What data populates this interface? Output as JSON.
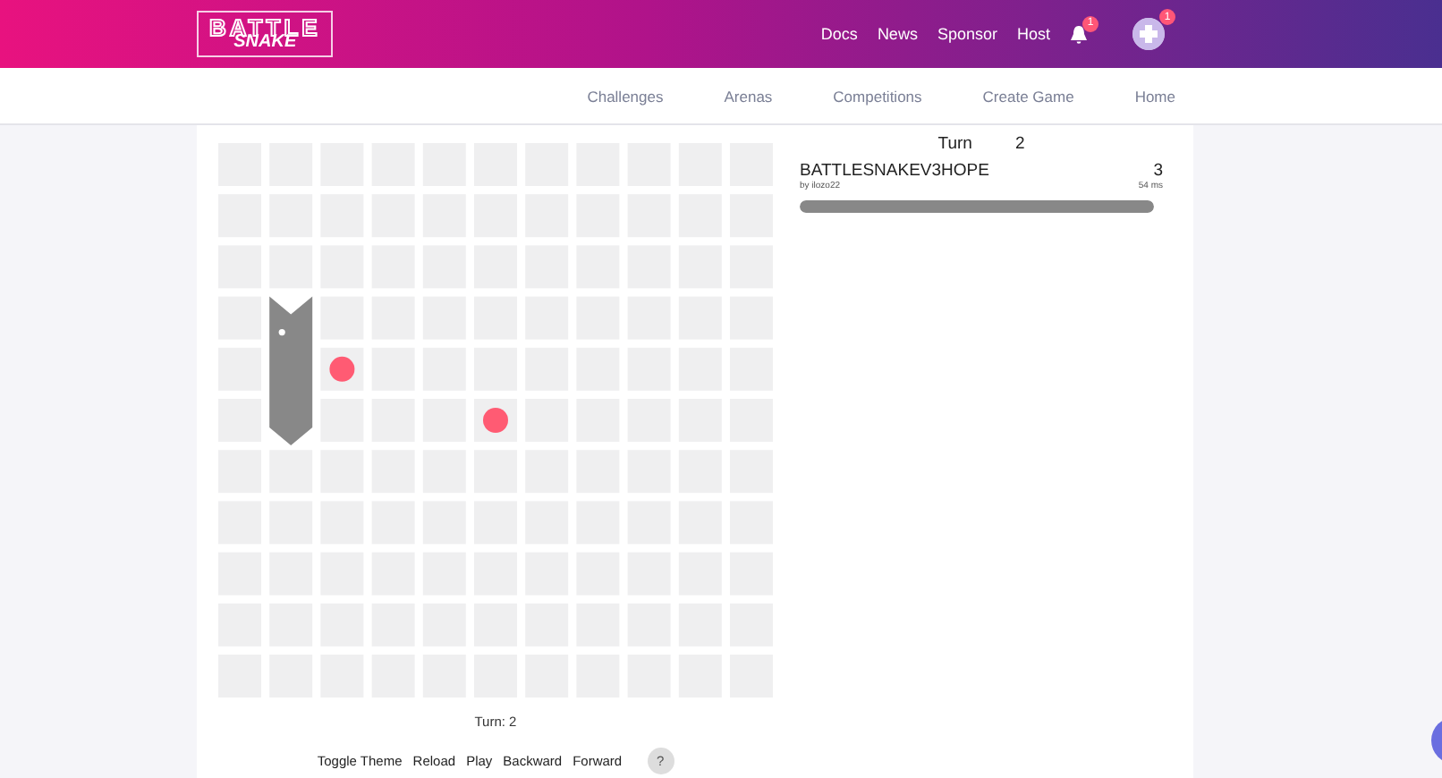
{
  "header": {
    "logo": [
      "BATTLE",
      "SNAKE"
    ],
    "links": [
      "Docs",
      "News",
      "Sponsor",
      "Host"
    ],
    "notification_badge": "1",
    "avatar_badge": "1"
  },
  "subnav": [
    "Challenges",
    "Arenas",
    "Competitions",
    "Create Game",
    "Home"
  ],
  "board": {
    "rows": [
      [
        {
          "kind": "empty"
        },
        {
          "kind": "empty"
        },
        {
          "kind": "empty"
        },
        {
          "kind": "empty"
        },
        {
          "kind": "empty"
        },
        {
          "kind": "empty"
        },
        {
          "kind": "empty"
        },
        {
          "kind": "empty"
        },
        {
          "kind": "empty"
        },
        {
          "kind": "empty"
        },
        {
          "kind": "empty"
        }
      ],
      [
        {
          "kind": "empty"
        },
        {
          "kind": "empty"
        },
        {
          "kind": "empty"
        },
        {
          "kind": "empty"
        },
        {
          "kind": "empty"
        },
        {
          "kind": "empty"
        },
        {
          "kind": "empty"
        },
        {
          "kind": "empty"
        },
        {
          "kind": "empty"
        },
        {
          "kind": "empty"
        },
        {
          "kind": "empty"
        }
      ],
      [
        {
          "kind": "empty"
        },
        {
          "kind": "empty"
        },
        {
          "kind": "empty"
        },
        {
          "kind": "empty"
        },
        {
          "kind": "empty"
        },
        {
          "kind": "empty"
        },
        {
          "kind": "empty"
        },
        {
          "kind": "empty"
        },
        {
          "kind": "empty"
        },
        {
          "kind": "empty"
        },
        {
          "kind": "empty"
        }
      ],
      [
        {
          "kind": "empty"
        },
        {
          "kind": "head"
        },
        {
          "kind": "empty"
        },
        {
          "kind": "empty"
        },
        {
          "kind": "empty"
        },
        {
          "kind": "empty"
        },
        {
          "kind": "empty"
        },
        {
          "kind": "empty"
        },
        {
          "kind": "empty"
        },
        {
          "kind": "empty"
        },
        {
          "kind": "empty"
        }
      ],
      [
        {
          "kind": "empty"
        },
        {
          "kind": "body"
        },
        {
          "kind": "food"
        },
        {
          "kind": "empty"
        },
        {
          "kind": "empty"
        },
        {
          "kind": "empty"
        },
        {
          "kind": "empty"
        },
        {
          "kind": "empty"
        },
        {
          "kind": "empty"
        },
        {
          "kind": "empty"
        },
        {
          "kind": "empty"
        }
      ],
      [
        {
          "kind": "empty"
        },
        {
          "kind": "tail"
        },
        {
          "kind": "empty"
        },
        {
          "kind": "empty"
        },
        {
          "kind": "empty"
        },
        {
          "kind": "food"
        },
        {
          "kind": "empty"
        },
        {
          "kind": "empty"
        },
        {
          "kind": "empty"
        },
        {
          "kind": "empty"
        },
        {
          "kind": "empty"
        }
      ],
      [
        {
          "kind": "empty"
        },
        {
          "kind": "empty"
        },
        {
          "kind": "empty"
        },
        {
          "kind": "empty"
        },
        {
          "kind": "empty"
        },
        {
          "kind": "empty"
        },
        {
          "kind": "empty"
        },
        {
          "kind": "empty"
        },
        {
          "kind": "empty"
        },
        {
          "kind": "empty"
        },
        {
          "kind": "empty"
        }
      ],
      [
        {
          "kind": "empty"
        },
        {
          "kind": "empty"
        },
        {
          "kind": "empty"
        },
        {
          "kind": "empty"
        },
        {
          "kind": "empty"
        },
        {
          "kind": "empty"
        },
        {
          "kind": "empty"
        },
        {
          "kind": "empty"
        },
        {
          "kind": "empty"
        },
        {
          "kind": "empty"
        },
        {
          "kind": "empty"
        }
      ],
      [
        {
          "kind": "empty"
        },
        {
          "kind": "empty"
        },
        {
          "kind": "empty"
        },
        {
          "kind": "empty"
        },
        {
          "kind": "empty"
        },
        {
          "kind": "empty"
        },
        {
          "kind": "empty"
        },
        {
          "kind": "empty"
        },
        {
          "kind": "empty"
        },
        {
          "kind": "empty"
        },
        {
          "kind": "empty"
        }
      ],
      [
        {
          "kind": "empty"
        },
        {
          "kind": "empty"
        },
        {
          "kind": "empty"
        },
        {
          "kind": "empty"
        },
        {
          "kind": "empty"
        },
        {
          "kind": "empty"
        },
        {
          "kind": "empty"
        },
        {
          "kind": "empty"
        },
        {
          "kind": "empty"
        },
        {
          "kind": "empty"
        },
        {
          "kind": "empty"
        }
      ],
      [
        {
          "kind": "empty"
        },
        {
          "kind": "empty"
        },
        {
          "kind": "empty"
        },
        {
          "kind": "empty"
        },
        {
          "kind": "empty"
        },
        {
          "kind": "empty"
        },
        {
          "kind": "empty"
        },
        {
          "kind": "empty"
        },
        {
          "kind": "empty"
        },
        {
          "kind": "empty"
        },
        {
          "kind": "empty"
        }
      ]
    ]
  },
  "scoreboard": {
    "turn_label": "Turn",
    "turn": "2",
    "snakes": [
      {
        "name": "BATTLESNAKEV3HOPE",
        "author": "by ilozo22",
        "length": "3",
        "latency": "54 ms",
        "color": "#888888",
        "level": 1.0
      }
    ]
  },
  "turn_caption": "Turn: 2",
  "controls": [
    "Toggle Theme",
    "Reload",
    "Play",
    "Backward",
    "Forward"
  ],
  "help": "?"
}
